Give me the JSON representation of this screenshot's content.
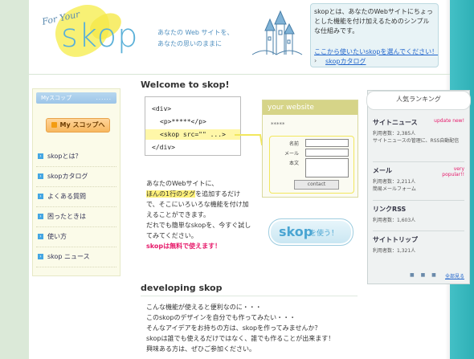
{
  "header": {
    "logo_for": "For Your",
    "logo_text": "skop",
    "tagline_line1": "あなたの Web サイトを、",
    "tagline_line2": "あなたの思いのままに",
    "info_text": "skopとは、あなたのWebサイトにちょっとした機能を付け加えるためのシンプルな仕組みです。",
    "info_link1": "ここから使いたいskopを選んでください！",
    "info_link2": "skopカタログ"
  },
  "sidebar": {
    "my_header": "Myスコップ",
    "my_header_dots": "......",
    "my_button": "My スコップへ",
    "items": [
      {
        "label": "skopとは？"
      },
      {
        "label": "skopカタログ"
      },
      {
        "label": "よくある質問"
      },
      {
        "label": "困ったときは"
      },
      {
        "label": "使い方"
      },
      {
        "label": "skop ニュース"
      }
    ]
  },
  "main": {
    "welcome_title": "Welcome to skop!",
    "code": {
      "line1": "<div>",
      "line2": "<p>*****</p>",
      "line3": "<skop src=\"\" ...>",
      "line4": "</div>"
    },
    "your_website": {
      "title": "your website",
      "stars": "*****",
      "field_name": "名前",
      "field_mail": "メール",
      "field_body": "本文",
      "submit": "contact"
    },
    "intro": {
      "line1": "あなたのWebサイトに、",
      "highlight": "ほんの1行のタグ",
      "line2_rest": "を追加するだけで、そこにいろいろな機能を付け加えることができます。",
      "line3": "だれでも簡単なskopを、今すぐ試してみてください。",
      "red": "skopは無料で使えます！"
    },
    "use_button_main": "skop",
    "use_button_sub": "を使う！",
    "dev_title": "developing skop",
    "dev_lines": [
      "こんな機能が使えると便利なのに・・・",
      "このskopのデザインを自分でも作ってみたい・・・",
      "そんなアイデアをお持ちの方は、skopを作ってみませんか？",
      "skopは誰でも使えるだけではなく、誰でも作ることが出来ます！",
      "興味ある方は、ぜひご参加ください。"
    ]
  },
  "ranking": {
    "title": "人気ランキング",
    "items": [
      {
        "name": "サイトニュース",
        "tag": "update new!",
        "users": "利用者数：2,385人",
        "desc": "サイトニュースの管理に、RSS自動配信"
      },
      {
        "name": "メール",
        "tag": "very popular!!",
        "users": "利用者数：2,211人",
        "desc": "簡易メールフォーム"
      },
      {
        "name": "リンクRSS",
        "tag": "",
        "users": "利用者数：1,603人",
        "desc": ""
      },
      {
        "name": "サイトトリップ",
        "tag": "",
        "users": "利用者数：1,321人",
        "desc": ""
      }
    ],
    "more": "全部見る",
    "dots": "■ ■ ■"
  }
}
